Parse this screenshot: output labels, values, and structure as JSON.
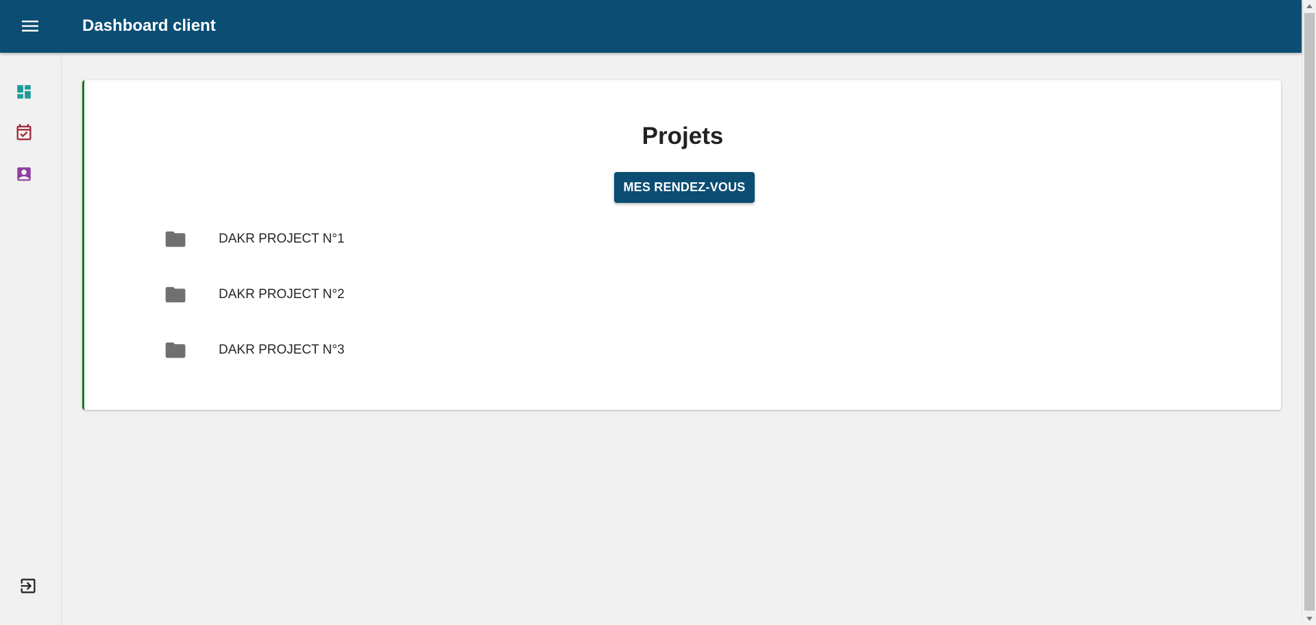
{
  "header": {
    "title": "Dashboard client",
    "menu_icon": "menu-icon"
  },
  "sidebar": {
    "items": [
      {
        "icon": "dashboard-icon",
        "color": "#1f9a9a"
      },
      {
        "icon": "calendar-check-icon",
        "color": "#9e2b3a"
      },
      {
        "icon": "contact-card-icon",
        "color": "#8e3fa0"
      }
    ],
    "logout_icon": "logout-icon"
  },
  "main": {
    "title": "Projets",
    "appointments_button": "MES RENDEZ-VOUS",
    "projects": [
      {
        "label": "DAKR PROJECT N°1",
        "icon": "folder-icon"
      },
      {
        "label": "DAKR PROJECT N°2",
        "icon": "folder-icon"
      },
      {
        "label": "DAKR PROJECT N°3",
        "icon": "folder-icon"
      }
    ]
  },
  "colors": {
    "primary": "#0b4d73",
    "card_accent": "#1a7a1a",
    "background": "#f1f1f1",
    "folder": "#707070"
  }
}
